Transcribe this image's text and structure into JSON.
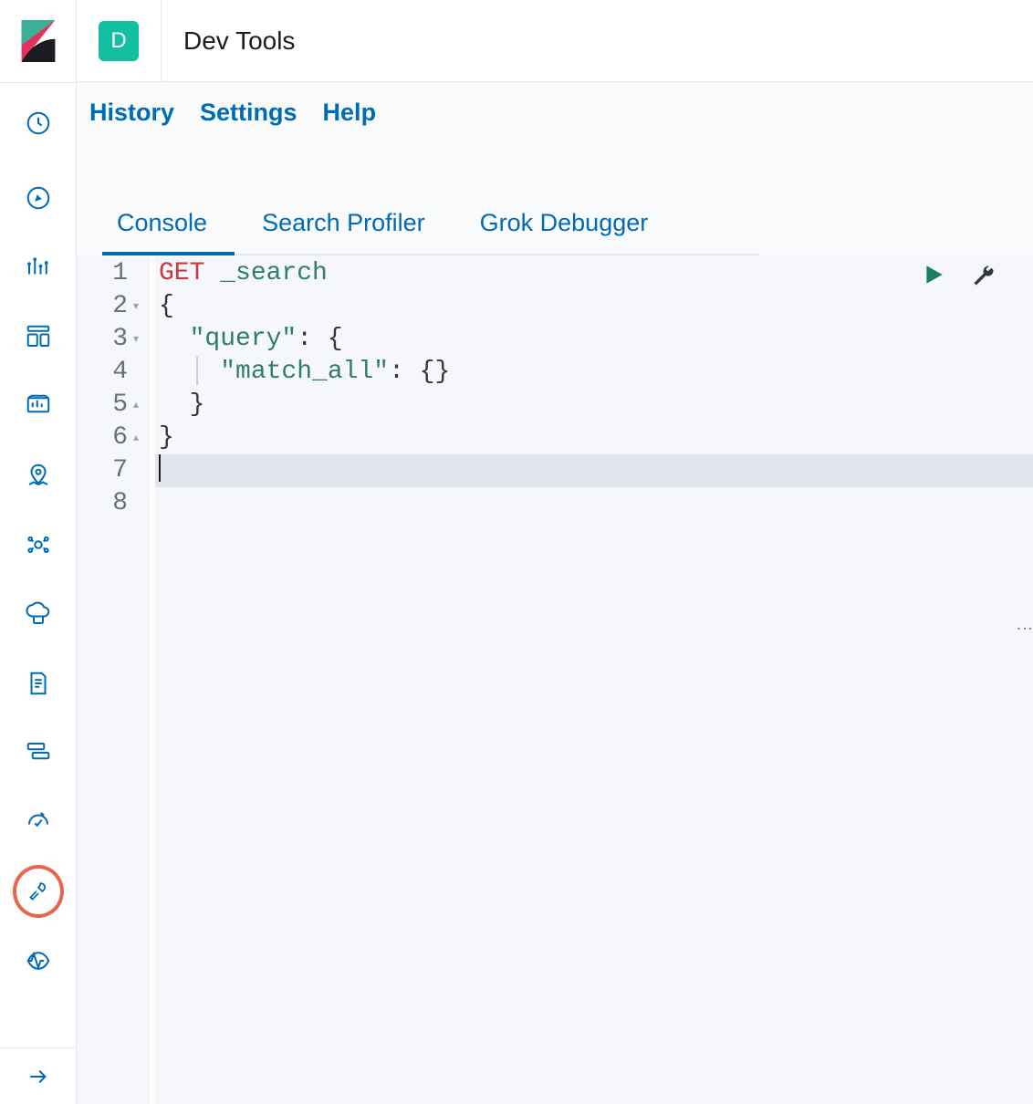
{
  "header": {
    "badge": "D",
    "title": "Dev Tools"
  },
  "toolbar": {
    "history": "History",
    "settings": "Settings",
    "help": "Help"
  },
  "tabs": [
    {
      "label": "Console",
      "active": true
    },
    {
      "label": "Search Profiler",
      "active": false
    },
    {
      "label": "Grok Debugger",
      "active": false
    }
  ],
  "editor": {
    "lines": [
      {
        "n": 1,
        "fold": "",
        "tokens": [
          {
            "t": "GET",
            "c": "tok-method"
          },
          {
            "t": " ",
            "c": ""
          },
          {
            "t": "_search",
            "c": "tok-path"
          }
        ]
      },
      {
        "n": 2,
        "fold": "▾",
        "tokens": [
          {
            "t": "{",
            "c": "tok-brace"
          }
        ]
      },
      {
        "n": 3,
        "fold": "▾",
        "tokens": [
          {
            "t": "  ",
            "c": ""
          },
          {
            "t": "\"query\"",
            "c": "tok-key"
          },
          {
            "t": ": ",
            "c": "tok-punc"
          },
          {
            "t": "{",
            "c": "tok-brace"
          }
        ]
      },
      {
        "n": 4,
        "fold": "",
        "tokens": [
          {
            "t": "  ",
            "c": ""
          },
          {
            "t": "│ ",
            "c": "tok-guide"
          },
          {
            "t": "\"match_all\"",
            "c": "tok-key"
          },
          {
            "t": ": ",
            "c": "tok-punc"
          },
          {
            "t": "{}",
            "c": "tok-brace"
          }
        ]
      },
      {
        "n": 5,
        "fold": "▴",
        "tokens": [
          {
            "t": "  ",
            "c": ""
          },
          {
            "t": "}",
            "c": "tok-brace"
          }
        ]
      },
      {
        "n": 6,
        "fold": "▴",
        "tokens": [
          {
            "t": "}",
            "c": "tok-brace"
          }
        ]
      },
      {
        "n": 7,
        "fold": "",
        "current": true,
        "tokens": []
      },
      {
        "n": 8,
        "fold": "",
        "tokens": []
      }
    ]
  },
  "sidebar": {
    "items": [
      {
        "name": "recent-icon"
      },
      {
        "name": "compass-icon"
      },
      {
        "name": "chart-icon"
      },
      {
        "name": "dashboard-icon"
      },
      {
        "name": "canvas-icon"
      },
      {
        "name": "maps-icon"
      },
      {
        "name": "ml-icon"
      },
      {
        "name": "infra-icon"
      },
      {
        "name": "logs-icon"
      },
      {
        "name": "apm-icon"
      },
      {
        "name": "uptime-icon"
      },
      {
        "name": "devtools-icon",
        "active": true
      },
      {
        "name": "monitoring-icon"
      }
    ],
    "expand": "expand-icon"
  }
}
